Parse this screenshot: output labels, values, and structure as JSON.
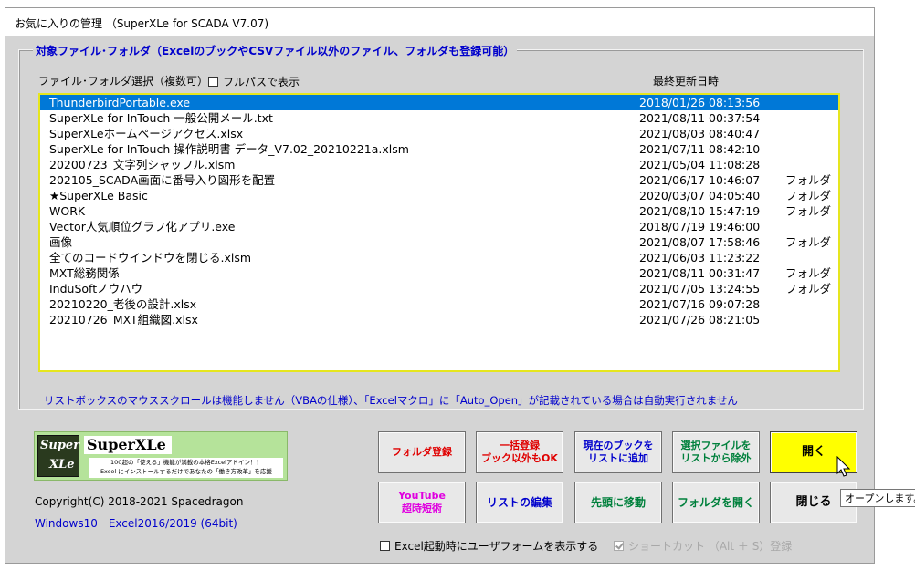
{
  "window": {
    "title": "お気に入りの管理 （SuperXLe for SCADA V7.07)"
  },
  "group": {
    "legend": "対象ファイル･フォルダ（ExcelのブックやCSVファイル以外のファイル、フォルダも登録可能）",
    "list_label": "ファイル･フォルダ選択（複数可）",
    "fullpath_label": "フルパスで表示",
    "fullpath_checked": false,
    "date_header": "最終更新日時"
  },
  "items": [
    {
      "name": "ThunderbirdPortable.exe",
      "date": "2018/01/26 08:13:56",
      "type": "",
      "selected": true
    },
    {
      "name": "SuperXLe for InTouch 一般公開メール.txt",
      "date": "2021/08/11 00:37:54",
      "type": ""
    },
    {
      "name": "SuperXLeホームページアクセス.xlsx",
      "date": "2021/08/03 08:40:47",
      "type": ""
    },
    {
      "name": "SuperXLe for InTouch 操作説明書 データ_V7.02_20210221a.xlsm",
      "date": "2021/07/11 08:42:10",
      "type": ""
    },
    {
      "name": "20200723_文字列シャッフル.xlsm",
      "date": "2021/05/04 11:08:28",
      "type": ""
    },
    {
      "name": "202105_SCADA画面に番号入り図形を配置",
      "date": "2021/06/17 10:46:07",
      "type": "フォルダ"
    },
    {
      "name": "★SuperXLe Basic",
      "date": "2020/03/07 04:05:40",
      "type": "フォルダ"
    },
    {
      "name": "WORK",
      "date": "2021/08/10 15:47:19",
      "type": "フォルダ"
    },
    {
      "name": "Vector人気順位グラフ化アプリ.exe",
      "date": "2018/07/19 19:46:00",
      "type": ""
    },
    {
      "name": "画像",
      "date": "2021/08/07 17:58:46",
      "type": "フォルダ"
    },
    {
      "name": "全てのコードウインドウを閉じる.xlsm",
      "date": "2021/06/03 11:23:22",
      "type": ""
    },
    {
      "name": "MXT総務関係",
      "date": "2021/08/11 00:31:47",
      "type": "フォルダ"
    },
    {
      "name": "InduSoftノウハウ",
      "date": "2021/07/05 13:24:55",
      "type": "フォルダ"
    },
    {
      "name": "20210220_老後の設計.xlsx",
      "date": "2021/07/16 09:07:28",
      "type": ""
    },
    {
      "name": "20210726_MXT組織図.xlsx",
      "date": "2021/07/26 08:21:05",
      "type": ""
    }
  ],
  "note": "リストボックスのマウススクロールは機能しません（VBAの仕様）、「Excelマクロ」に「Auto_Open」が記載されている場合は自動実行されません",
  "logo": {
    "emblem_line1": "Super",
    "emblem_line2": "XLe",
    "name": "SuperXLe",
    "tagline_1": "100超の「使える」機能が満載の本格Excelアドイン！！",
    "tagline_2": "Excel にインストールするだけであなたの「働き方改革」を応援"
  },
  "copyright": "Copyright(C) 2018-2021 Spacedragon",
  "environment": "Windows10　Excel2016/2019 (64bit)",
  "buttons": {
    "folder_register": "フォルダ登録",
    "bulk_register_1": "一括登録",
    "bulk_register_2": "ブック以外もOK",
    "add_current_1": "現在のブックを",
    "add_current_2": "リストに追加",
    "remove_selected_1": "選択ファイルを",
    "remove_selected_2": "リストから除外",
    "open": "開く",
    "youtube_1": "YouTube",
    "youtube_2": "超時短術",
    "edit_list": "リストの編集",
    "move_top": "先頭に移動",
    "open_folder": "フォルダを開く",
    "close": "閉じる"
  },
  "startup_check": {
    "label": "Excel起動時にユーザフォームを表示する",
    "checked": false
  },
  "shortcut_check": {
    "label": "ショートカット （Alt ＋ S）登録",
    "checked": true
  },
  "tooltip": "オープンします。",
  "colors": {
    "selection": "#0078d7",
    "open_button": "#ffff00",
    "accent_text": "#0000cc",
    "listbox_border": "#e6e61e"
  }
}
